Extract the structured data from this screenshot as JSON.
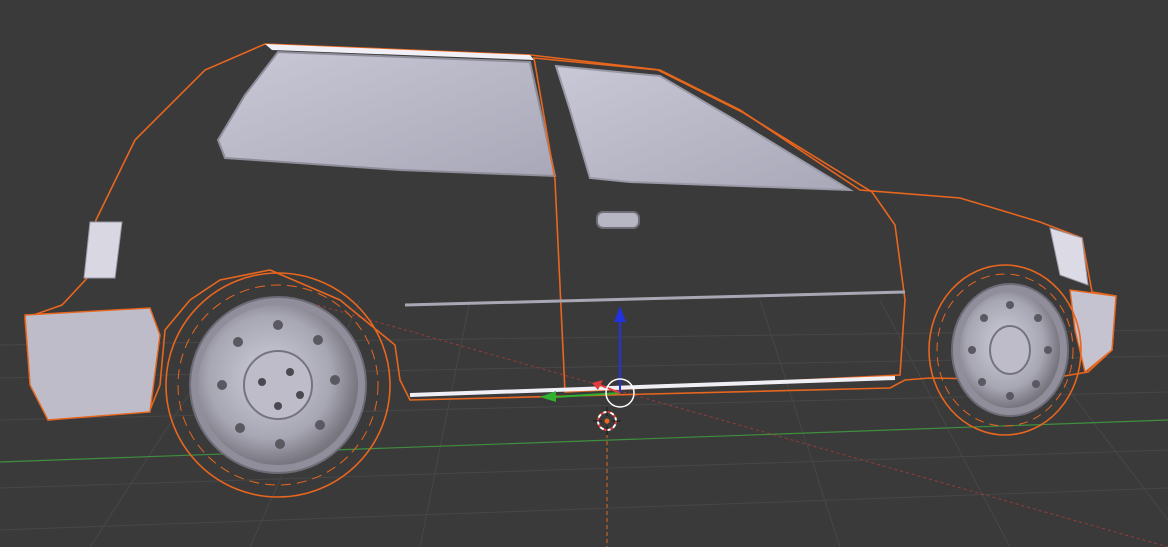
{
  "viewport": {
    "background": "#3a3a3a",
    "grid_color": "#4a4a4a",
    "x_axis_color": "#9a3a3a",
    "y_axis_color": "#3f8f3f"
  },
  "scene": {
    "object": "car",
    "selected": true,
    "selection_outline_color": "#e8661e",
    "body_color": "#c9c8d3"
  },
  "gizmo": {
    "x_axis_color": "#e03a3a",
    "y_axis_color": "#2fb02f",
    "z_axis_color": "#2233dd"
  },
  "cursor_3d": {
    "colors": [
      "#e03a3a",
      "#ffffff"
    ]
  },
  "icons": {
    "transform_gizmo": "transform-gizmo-icon",
    "cursor_3d": "3d-cursor-icon"
  }
}
